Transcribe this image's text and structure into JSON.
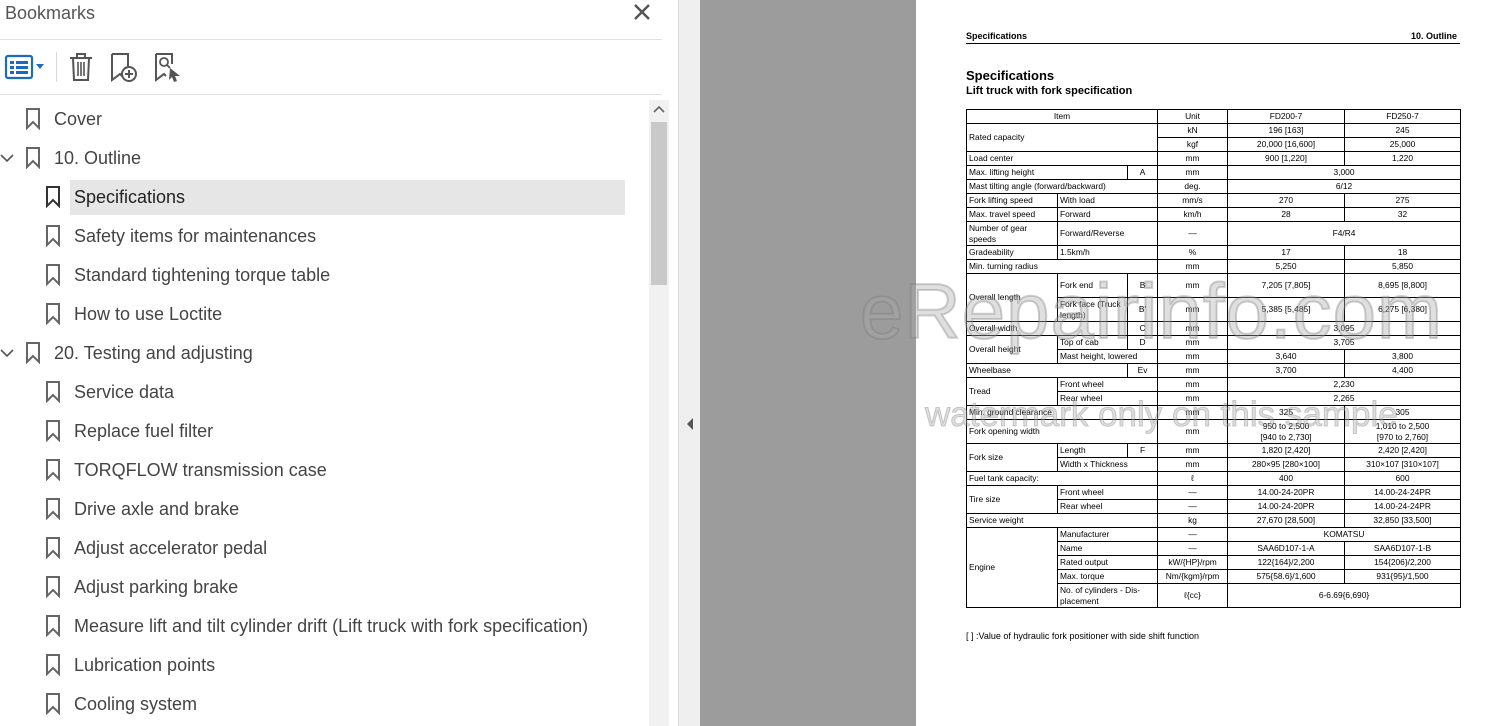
{
  "bookmarks_panel": {
    "title": "Bookmarks",
    "toolbar": {
      "options_icon": "list-options-icon",
      "delete_icon": "trash-icon",
      "add_icon": "add-bookmark-icon",
      "find_icon": "find-current-bookmark-icon"
    },
    "items": [
      {
        "label": "Cover",
        "level": 0,
        "expander": "",
        "selected": false
      },
      {
        "label": "10. Outline",
        "level": 0,
        "expander": "expanded",
        "selected": false
      },
      {
        "label": "Specifications",
        "level": 1,
        "expander": "",
        "selected": true
      },
      {
        "label": "Safety items for maintenances",
        "level": 1,
        "expander": "",
        "selected": false
      },
      {
        "label": "Standard tightening torque table",
        "level": 1,
        "expander": "",
        "selected": false
      },
      {
        "label": "How to use Loctite",
        "level": 1,
        "expander": "",
        "selected": false
      },
      {
        "label": "20. Testing and adjusting",
        "level": 0,
        "expander": "expanded",
        "selected": false
      },
      {
        "label": "Service data",
        "level": 1,
        "expander": "",
        "selected": false
      },
      {
        "label": "Replace fuel filter",
        "level": 1,
        "expander": "",
        "selected": false
      },
      {
        "label": "TORQFLOW transmission case",
        "level": 1,
        "expander": "",
        "selected": false
      },
      {
        "label": "Drive axle and brake",
        "level": 1,
        "expander": "",
        "selected": false
      },
      {
        "label": "Adjust accelerator pedal",
        "level": 1,
        "expander": "",
        "selected": false
      },
      {
        "label": "Adjust parking brake",
        "level": 1,
        "expander": "",
        "selected": false
      },
      {
        "label": "Measure lift and tilt cylinder drift (Lift truck with fork specification)",
        "level": 1,
        "expander": "",
        "selected": false
      },
      {
        "label": "Lubrication points",
        "level": 1,
        "expander": "",
        "selected": false
      },
      {
        "label": "Cooling system",
        "level": 1,
        "expander": "",
        "selected": false
      }
    ]
  },
  "document": {
    "header_left": "Specifications",
    "header_right": "10. Outline",
    "title": "Specifications",
    "subtitle": "Lift truck with fork specification",
    "columns": [
      "Item",
      "Unit",
      "FD200-7",
      "FD250-7"
    ],
    "footnote": "[ ] :Value of hydraulic fork positioner with side shift function",
    "rows": {
      "rated_capacity": {
        "item": "Rated capacity",
        "kn_unit": "kN",
        "kn_a": "196 [163]",
        "kn_b": "245",
        "kgf_unit": "kgf",
        "kgf_a": "20,000 [16,600]",
        "kgf_b": "25,000"
      },
      "load_center": {
        "item": "Load center",
        "unit": "mm",
        "a": "900 [1,220]",
        "b": "1,220"
      },
      "max_lift": {
        "item": "Max. lifting height",
        "sym": "A",
        "unit": "mm",
        "v": "3,000"
      },
      "mast_tilt": {
        "item": "Mast tilting angle (forward/backward)",
        "unit": "deg.",
        "v": "6/12"
      },
      "fork_speed": {
        "item": "Fork lifting speed",
        "sub": "With load",
        "unit": "mm/s",
        "a": "270",
        "b": "275"
      },
      "travel_speed": {
        "item": "Max. travel speed",
        "sub": "Forward",
        "unit": "km/h",
        "a": "28",
        "b": "32"
      },
      "gear_speeds": {
        "item": "Number of gear speeds",
        "sub": "Forward/Reverse",
        "unit": "—",
        "v": "F4/R4"
      },
      "gradeability": {
        "item": "Gradeability",
        "sub": "1.5km/h",
        "unit": "%",
        "a": "17",
        "b": "18"
      },
      "turning_radius": {
        "item": "Min. turning radius",
        "unit": "mm",
        "a": "5,250",
        "b": "5,850"
      },
      "overall_length": {
        "item": "Overall length",
        "sub1": "Fork end",
        "sym1": "B",
        "unit1": "mm",
        "a1": "7,205 [7,805]",
        "b1": "8,695 [8,800]",
        "sub2": "Fork face (Truck length)",
        "sym2": "B'",
        "unit2": "mm",
        "a2": "5,385 [5,485]",
        "b2": "6,275 [6,380]"
      },
      "overall_width": {
        "item": "Overall width",
        "sym": "C",
        "unit": "mm",
        "v": "3,095"
      },
      "overall_height": {
        "item": "Overall height",
        "sub1": "Top of cab",
        "sym1": "D",
        "unit1": "mm",
        "v1": "3,705",
        "sub2": "Mast height, lowered",
        "unit2": "mm",
        "a2": "3,640",
        "b2": "3,800"
      },
      "wheelbase": {
        "item": "Wheelbase",
        "sym": "Ev",
        "unit": "mm",
        "a": "3,700",
        "b": "4,400"
      },
      "tread": {
        "item": "Tread",
        "sub1": "Front wheel",
        "unit1": "mm",
        "v1": "2,230",
        "sub2": "Rear wheel",
        "unit2": "mm",
        "v2": "2,265"
      },
      "ground_clearance": {
        "item": "Min. ground clearance",
        "unit": "mm",
        "a": "325",
        "b": "305"
      },
      "fork_opening": {
        "item": "Fork opening width",
        "unit": "mm",
        "a1": "950 to 2,500",
        "a2": "[940 to 2,730]",
        "b1": "1,010 to 2,500",
        "b2": "[970 to 2,760]"
      },
      "fork_size": {
        "item": "Fork size",
        "sub1": "Length",
        "sym1": "F",
        "unit1": "mm",
        "a1": "1,820 [2,420]",
        "b1": "2,420 [2,420]",
        "sub2": "Width x Thickness",
        "unit2": "mm",
        "a2": "280×95 [280×100]",
        "b2": "310×107 [310×107]"
      },
      "fuel_tank": {
        "item": "Fuel tank capacity:",
        "unit": "ℓ",
        "a": "400",
        "b": "600"
      },
      "tire_size": {
        "item": "Tire size",
        "sub1": "Front wheel",
        "unit1": "—",
        "a1": "14.00-24-20PR",
        "b1": "14.00-24-24PR",
        "sub2": "Rear wheel",
        "unit2": "—",
        "a2": "14.00-24-20PR",
        "b2": "14.00-24-24PR"
      },
      "service_weight": {
        "item": "Service weight",
        "unit": "kg",
        "a": "27,670 [28,500]",
        "b": "32,850 [33,500]"
      },
      "engine": {
        "item": "Engine",
        "manufacturer": {
          "sub": "Manufacturer",
          "unit": "—",
          "v": "KOMATSU"
        },
        "name": {
          "sub": "Name",
          "unit": "—",
          "a": "SAA6D107-1-A",
          "b": "SAA6D107-1-B"
        },
        "output": {
          "sub": "Rated output",
          "unit": "kW/{HP}/rpm",
          "a": "122{164}/2,200",
          "b": "154{206}/2,200"
        },
        "torque": {
          "sub": "Max. torque",
          "unit": "Nm/{kgm}/rpm",
          "a": "575{58.6}/1,600",
          "b": "931{95}/1,500"
        },
        "cylinders": {
          "sub": "No. of cylinders - Dis-placement",
          "unit": "ℓ{cc}",
          "v": "6-6.69{6,690}"
        }
      }
    }
  },
  "watermark": {
    "main": "eRepairinfo.com",
    "sub": "watermark only on this sample"
  }
}
